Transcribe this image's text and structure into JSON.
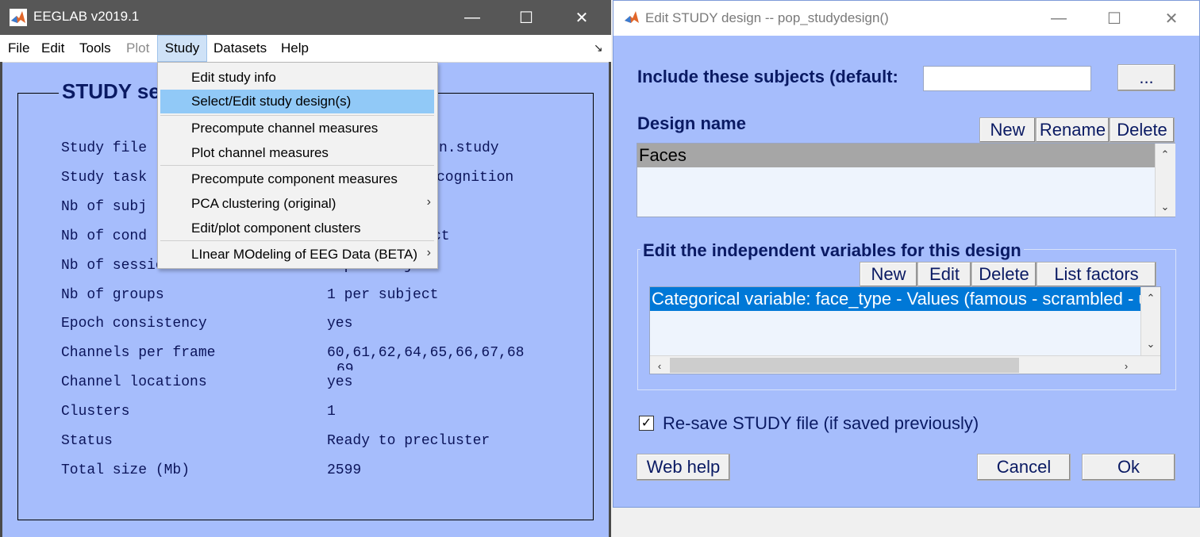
{
  "eeglab": {
    "title": "EEGLAB v2019.1",
    "menu": [
      "File",
      "Edit",
      "Tools",
      "Plot",
      "Study",
      "Datasets",
      "Help"
    ],
    "study_title": "STUDY se",
    "rows": [
      {
        "label": "Study file",
        "value": "n.study"
      },
      {
        "label": "Study task",
        "value": "cognition"
      },
      {
        "label": "Nb of subj",
        "value": ""
      },
      {
        "label": "Nb of cond",
        "value": "ct"
      },
      {
        "label": "Nb of sessions",
        "value": "1 per subject"
      },
      {
        "label": "Nb of groups",
        "value": "1 per subject"
      },
      {
        "label": "Epoch consistency",
        "value": "yes"
      },
      {
        "label": "Channels per frame",
        "value": "60,61,62,64,65,66,67,68"
      },
      {
        "label": "Channel locations",
        "value": "yes"
      },
      {
        "label": "Clusters",
        "value": "1"
      },
      {
        "label": "Status",
        "value": "Ready to precluster"
      },
      {
        "label": "Total size (Mb)",
        "value": "2599"
      }
    ],
    "channels_overflow": "69",
    "study_menu": [
      "Edit study info",
      "Select/Edit study design(s)",
      "Precompute channel measures",
      "Plot channel measures",
      "Precompute component measures",
      "PCA clustering (original)",
      "Edit/plot component clusters",
      "LInear MOdeling of EEG Data (BETA)"
    ]
  },
  "dialog": {
    "title": "Edit STUDY design -- pop_studydesign()",
    "include_label": "Include these subjects (default:",
    "include_value": "",
    "browse_label": "...",
    "design_name_label": "Design name",
    "design_buttons": [
      "New",
      "Rename",
      "Delete"
    ],
    "designs": [
      "Faces"
    ],
    "variables_group_label": "Edit the independent variables for this design",
    "variable_buttons": [
      "New",
      "Edit",
      "Delete",
      "List factors"
    ],
    "variables": [
      "Categorical variable: face_type - Values (famous - scrambled - unfamiliar)"
    ],
    "resave_label": "Re-save STUDY file (if saved previously)",
    "resave_checked": true,
    "web_help": "Web help",
    "cancel": "Cancel",
    "ok": "Ok"
  },
  "colors": {
    "panel_bg": "#a6bdfc",
    "label_text": "#0a1a63",
    "selection": "#0078d7"
  }
}
